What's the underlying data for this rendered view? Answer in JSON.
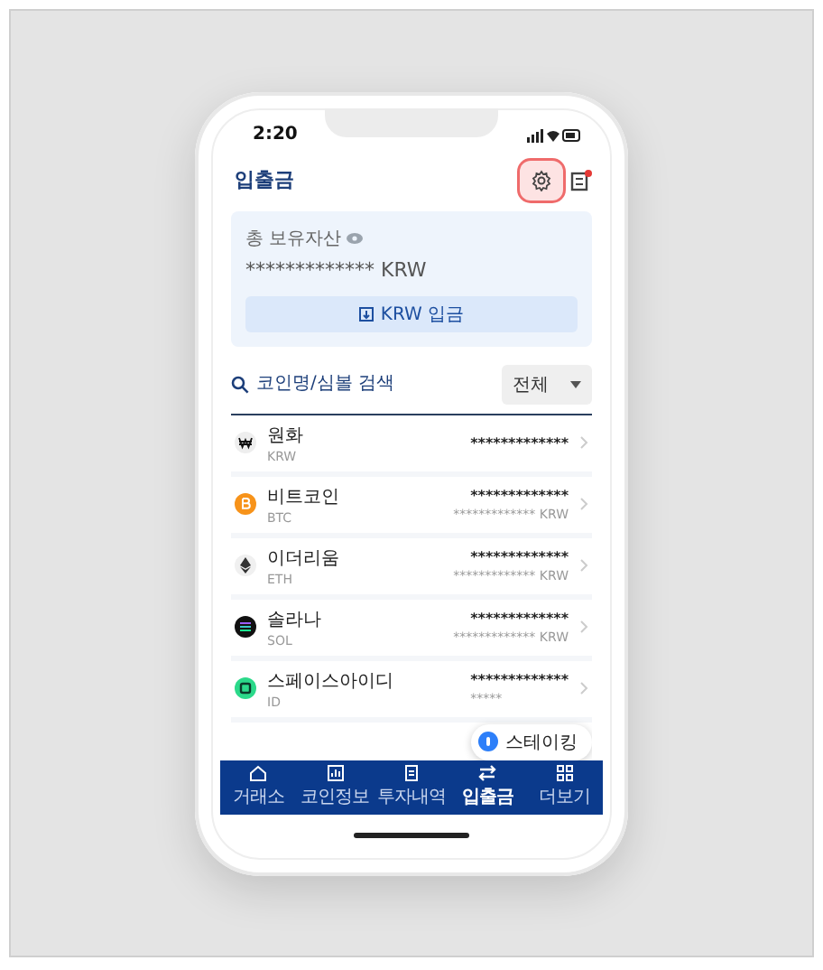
{
  "status_bar": {
    "time": "2:20"
  },
  "header": {
    "title": "입출금",
    "settings_highlighted": true,
    "notification_dot": true
  },
  "assets": {
    "label": "총 보유자산",
    "amount": "************* KRW",
    "deposit_button": "KRW 입금"
  },
  "search": {
    "placeholder": "코인명/심볼 검색",
    "filter": "전체"
  },
  "coins": [
    {
      "name": "원화",
      "symbol": "KRW",
      "balance": "*************",
      "color": "#eeeeee"
    },
    {
      "name": "비트코인",
      "symbol": "BTC",
      "balance": "*************",
      "value": "************* KRW",
      "color": "#f7931a"
    },
    {
      "name": "이더리움",
      "symbol": "ETH",
      "balance": "*************",
      "value": "************* KRW",
      "color": "#f0f0f0"
    },
    {
      "name": "솔라나",
      "symbol": "SOL",
      "balance": "*************",
      "value": "************* KRW",
      "color": "#111111"
    },
    {
      "name": "스페이스아이디",
      "symbol": "ID",
      "balance": "*************",
      "value": "*****",
      "color": "#2bd98a"
    }
  ],
  "staking_button": "스테이킹",
  "nav": [
    {
      "label": "거래소",
      "selected": false
    },
    {
      "label": "코인정보",
      "selected": false
    },
    {
      "label": "투자내역",
      "selected": false
    },
    {
      "label": "입출금",
      "selected": true
    },
    {
      "label": "더보기",
      "selected": false
    }
  ]
}
